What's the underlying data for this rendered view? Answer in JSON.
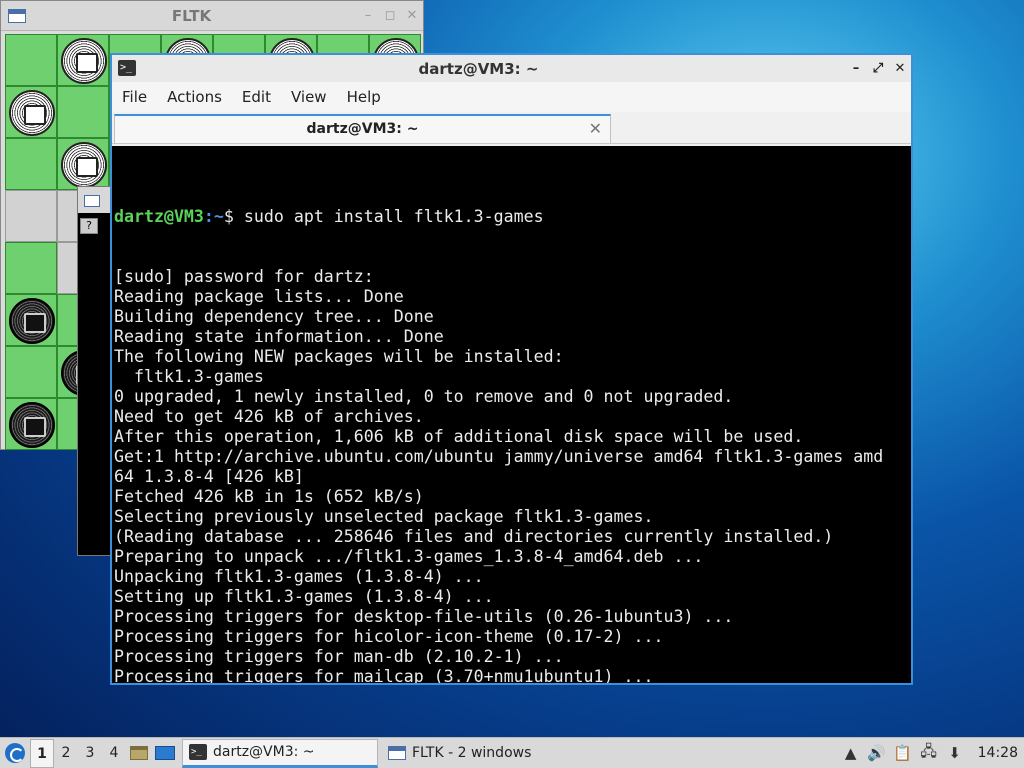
{
  "fltk_window": {
    "title": "FLTK",
    "board": [
      [
        "g:",
        "g:white",
        "g:",
        "g:white",
        "g:",
        "g:white",
        "g:",
        "g:white"
      ],
      [
        "g:white",
        "g:",
        "g:",
        "g:",
        "g:",
        "g:",
        "g:",
        "g:"
      ],
      [
        "g:",
        "g:white",
        "g:",
        "g:",
        "g:",
        "g:",
        "g:",
        "g:"
      ],
      [
        "w:",
        "w:",
        "g:",
        "g:",
        "g:",
        "g:",
        "g:",
        "g:"
      ],
      [
        "g:",
        "w:",
        "g:",
        "g:",
        "g:",
        "g:",
        "g:",
        "g:"
      ],
      [
        "g:black",
        "g:",
        "g:",
        "g:",
        "g:",
        "g:",
        "g:",
        "g:"
      ],
      [
        "g:",
        "g:black",
        "g:",
        "g:",
        "g:",
        "g:",
        "g:",
        "g:"
      ],
      [
        "g:black",
        "g:",
        "g:",
        "g:",
        "g:",
        "g:",
        "g:",
        "g:"
      ]
    ],
    "dialog_help": "?"
  },
  "terminal": {
    "title": "dartz@VM3: ~",
    "menu": [
      "File",
      "Actions",
      "Edit",
      "View",
      "Help"
    ],
    "tab_label": "dartz@VM3: ~",
    "prompt_user": "dartz@VM3",
    "prompt_path": ":~",
    "prompt_sym": "$ ",
    "command": "sudo apt install fltk1.3-games",
    "output": [
      "[sudo] password for dartz:",
      "Reading package lists... Done",
      "Building dependency tree... Done",
      "Reading state information... Done",
      "The following NEW packages will be installed:",
      "  fltk1.3-games",
      "0 upgraded, 1 newly installed, 0 to remove and 0 not upgraded.",
      "Need to get 426 kB of archives.",
      "After this operation, 1,606 kB of additional disk space will be used.",
      "Get:1 http://archive.ubuntu.com/ubuntu jammy/universe amd64 fltk1.3-games amd",
      "64 1.3.8-4 [426 kB]",
      "Fetched 426 kB in 1s (652 kB/s)",
      "Selecting previously unselected package fltk1.3-games.",
      "(Reading database ... 258646 files and directories currently installed.)",
      "Preparing to unpack .../fltk1.3-games_1.3.8-4_amd64.deb ...",
      "Unpacking fltk1.3-games (1.3.8-4) ...",
      "Setting up fltk1.3-games (1.3.8-4) ...",
      "Processing triggers for desktop-file-utils (0.26-1ubuntu3) ...",
      "Processing triggers for hicolor-icon-theme (0.17-2) ...",
      "Processing triggers for man-db (2.10.2-1) ...",
      "Processing triggers for mailcap (3.70+nmu1ubuntu1) ..."
    ]
  },
  "taskbar": {
    "workspaces": [
      "1",
      "2",
      "3",
      "4"
    ],
    "tasks": [
      {
        "label": "dartz@VM3: ~",
        "icon": "terminal-icon"
      },
      {
        "label": "FLTK - 2 windows",
        "icon": "fltk-window-icon"
      }
    ],
    "clock": "14:28"
  },
  "colors": {
    "accent": "#3c8fd8",
    "prompt_user": "#5bd35b",
    "prompt_path": "#4d8fe6",
    "board_green": "#6fd06f",
    "board_gray": "#d2d2d2"
  }
}
